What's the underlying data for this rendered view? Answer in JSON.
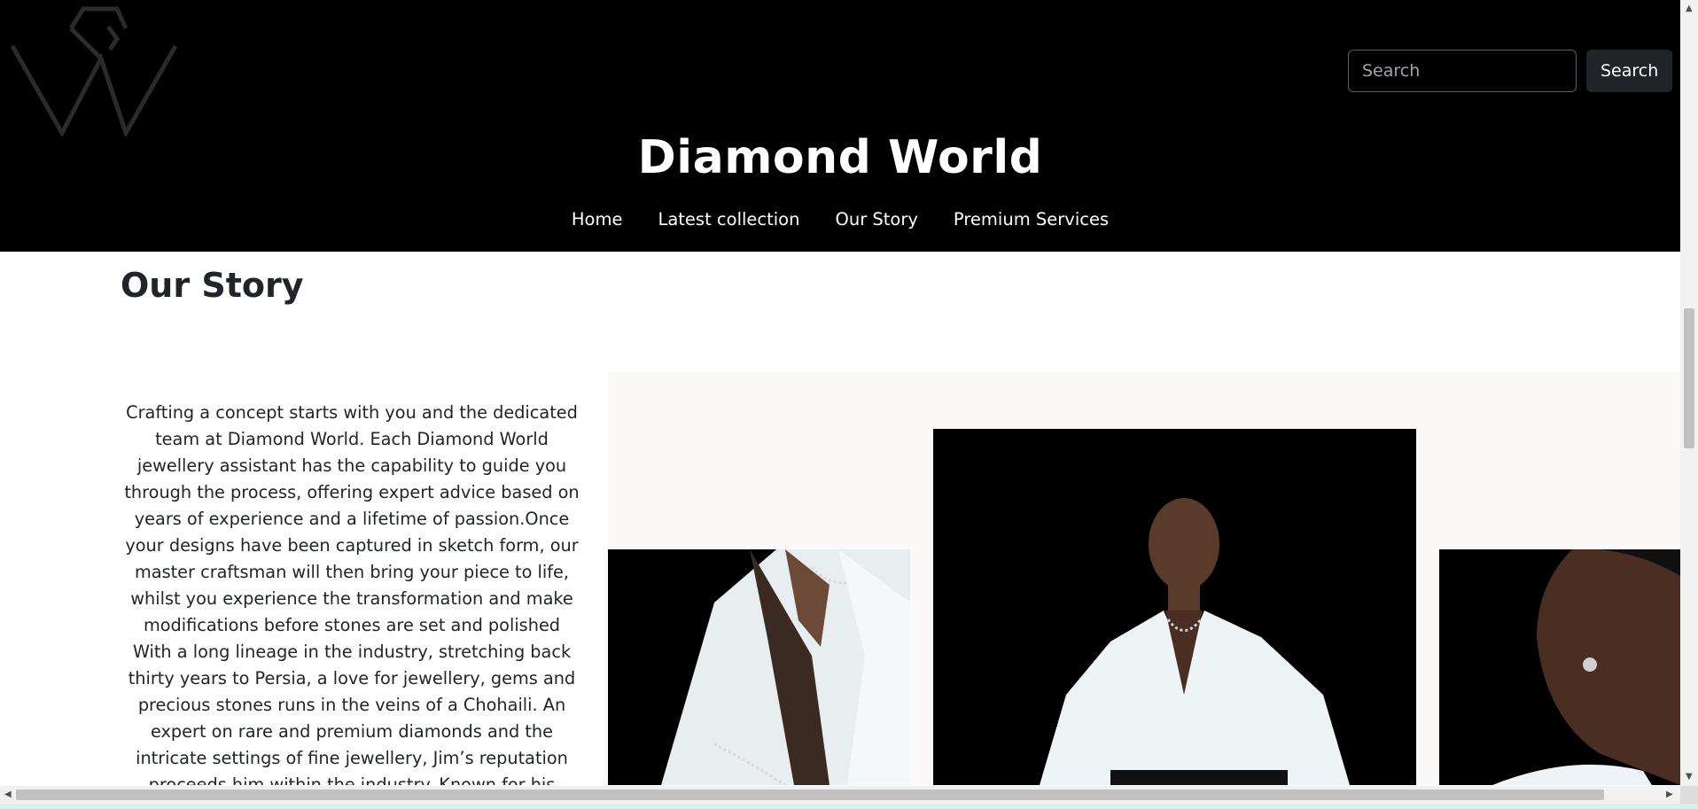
{
  "header": {
    "search_placeholder": "Search",
    "search_button": "Search",
    "site_title": "Diamond World",
    "nav": [
      {
        "label": "Home"
      },
      {
        "label": "Latest collection"
      },
      {
        "label": "Our Story"
      },
      {
        "label": "Premium Services"
      }
    ]
  },
  "main": {
    "heading": "Our Story",
    "paragraphs": [
      "Crafting a concept starts with you and the dedicated team at Diamond World. Each Diamond World jewellery assistant has the capability to guide you through the process, offering expert advice based on years of experience and a lifetime of passion.Once your designs have been captured in sketch form, our master craftsman will then bring your piece to life, whilst you experience the transformation and make modifications before stones are set and polished",
      "With a long lineage in the industry, stretching back thirty years to Persia, a love for jewellery, gems and precious stones runs in the veins of a Chohaili. An expert on rare and premium diamonds and the intricate settings of fine jewellery, Jim’s reputation proceeds him within the industry. Known for his creative flair and respect for the"
    ]
  },
  "colors": {
    "header_bg": "#000000",
    "text": "#212529",
    "gallery_bg": "#fbf8f8"
  }
}
